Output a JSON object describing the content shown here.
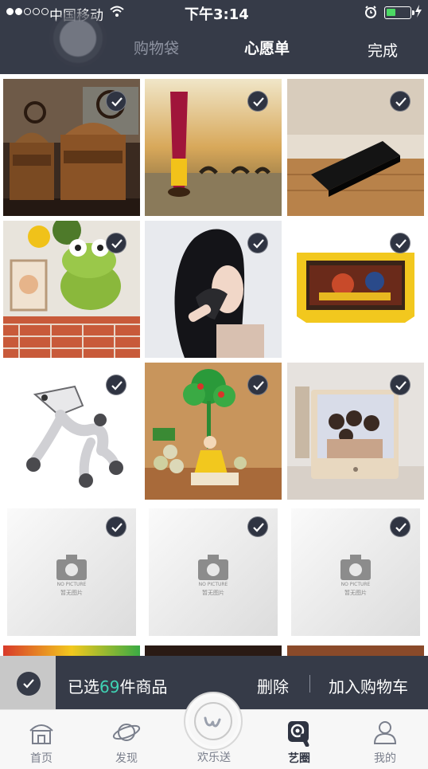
{
  "status_bar": {
    "carrier": "中国移动",
    "time": "下午3:14"
  },
  "header": {
    "tab_cart": "购物袋",
    "tab_wishlist": "心愿单",
    "done_label": "完成"
  },
  "products": [
    {
      "name": "coffee-grinders",
      "selected": true
    },
    {
      "name": "camel-perfume",
      "selected": true
    },
    {
      "name": "black-gadget",
      "selected": true
    },
    {
      "name": "frog-plush",
      "selected": true
    },
    {
      "name": "hair-dryer",
      "selected": true
    },
    {
      "name": "game-cartridge",
      "selected": true
    },
    {
      "name": "robot-toy",
      "selected": true
    },
    {
      "name": "tree-figurine",
      "selected": true
    },
    {
      "name": "photo-frame",
      "selected": true
    },
    {
      "name": "no-picture",
      "selected": true,
      "placeholder_en": "NO PICTURE",
      "placeholder_cn": "暂无图片"
    },
    {
      "name": "no-picture",
      "selected": true,
      "placeholder_en": "NO PICTURE",
      "placeholder_cn": "暂无图片"
    },
    {
      "name": "no-picture",
      "selected": true,
      "placeholder_en": "NO PICTURE",
      "placeholder_cn": "暂无图片"
    }
  ],
  "action_bar": {
    "selected_prefix": "已选",
    "selected_count": "69",
    "selected_suffix": "件商品",
    "delete_label": "删除",
    "add_to_cart_label": "加入购物车"
  },
  "tab_bar": {
    "items": [
      {
        "label": "首页",
        "icon": "home-icon"
      },
      {
        "label": "发现",
        "icon": "planet-icon"
      },
      {
        "label": "欢乐送",
        "icon": "center-logo-icon"
      },
      {
        "label": "艺圈",
        "icon": "circle-touch-icon",
        "active": true
      },
      {
        "label": "我的",
        "icon": "user-icon"
      }
    ]
  },
  "colors": {
    "dark_bar": "#363b48",
    "accent_count": "#3fd3b4",
    "check_bg": "#2f3442"
  }
}
